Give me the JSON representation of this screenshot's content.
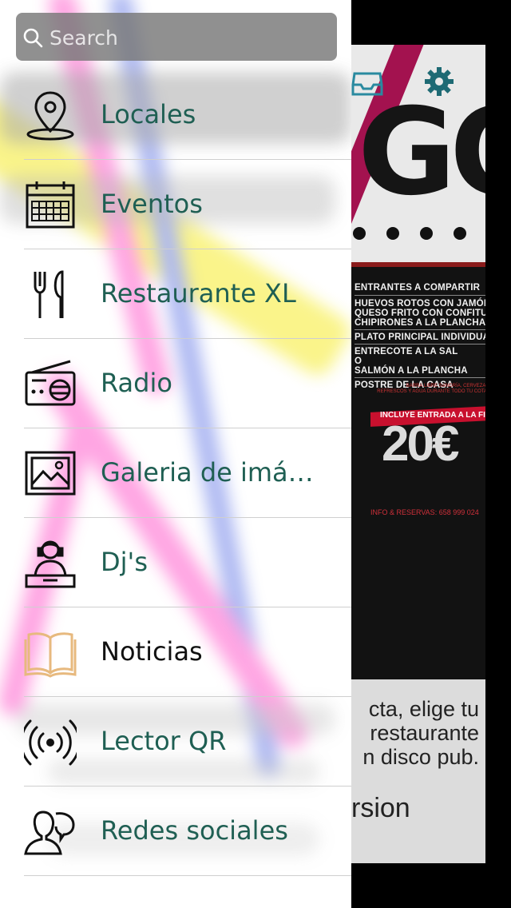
{
  "search": {
    "placeholder": "Search"
  },
  "menu": {
    "items": [
      {
        "label": "Locales",
        "icon": "location-pin-icon"
      },
      {
        "label": "Eventos",
        "icon": "calendar-icon"
      },
      {
        "label": "Restaurante XL",
        "icon": "fork-knife-icon"
      },
      {
        "label": "Radio",
        "icon": "radio-icon"
      },
      {
        "label": "Galeria de imá…",
        "icon": "image-gallery-icon"
      },
      {
        "label": "Dj's",
        "icon": "dj-icon"
      },
      {
        "label": "Noticias",
        "icon": "open-book-icon"
      },
      {
        "label": "Lector QR",
        "icon": "broadcast-icon"
      },
      {
        "label": "Redes sociales",
        "icon": "social-people-icon"
      }
    ]
  },
  "background": {
    "logo_text": "GO",
    "poster_lines": [
      "ENTRANTES A COMPARTIR",
      "HUEVOS ROTOS CON JAMÓN",
      "QUESO FRITO CON CONFITURA",
      "CHIPIRONES A LA PLANCHA",
      "PLATO PRINCIPAL INDIVIDUAL",
      "ENTRECOTE A LA SAL",
      "O",
      "SALMÓN A LA PLANCHA",
      "POSTRE DE LA CASA"
    ],
    "poster_small_text": "BARRA LIBRE SANGRÍA, CERVEZA, REFRESCOS Y AGUA DURANTE TODO TU COTA",
    "poster_banner": "INCLUYE ENTRADA A LA FIESTA",
    "poster_price": "20€",
    "poster_info": "INFO & RESERVAS: 658 999 024",
    "body_text_lines": [
      "cta, elige tu",
      "restaurante",
      "n disco pub."
    ],
    "body_heading": "rsion"
  },
  "colors": {
    "menu_text": "#1f5f53",
    "menu_text_dark": "#111111",
    "noticias_icon": "#e7b97e",
    "stripe_magenta": "#a3124f"
  }
}
